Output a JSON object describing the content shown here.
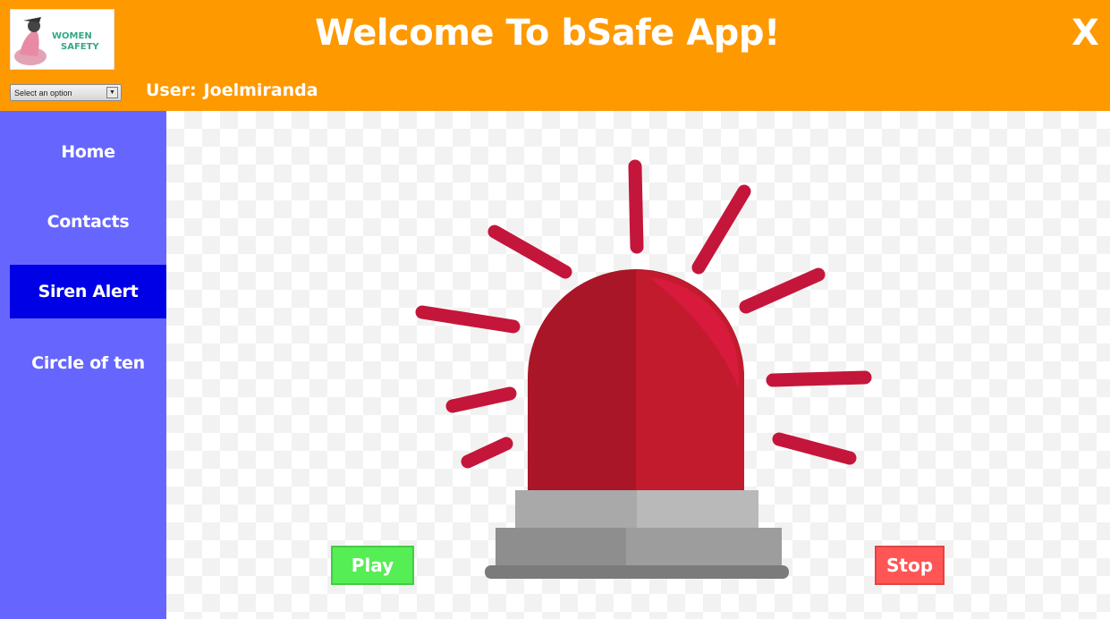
{
  "header": {
    "title": "Welcome To bSafe App!",
    "close_label": "X",
    "logo": {
      "text_line1": "WOMEN",
      "text_line2": "SAFETY"
    },
    "select": {
      "value": "Select an option",
      "arrow": "▼"
    },
    "user": {
      "label": "User:",
      "name": "Joelmiranda"
    }
  },
  "sidebar": {
    "items": [
      {
        "label": "Home",
        "active": false
      },
      {
        "label": "Contacts",
        "active": false
      },
      {
        "label": "Siren Alert",
        "active": true
      },
      {
        "label": "Circle of ten",
        "active": false
      }
    ]
  },
  "main": {
    "illustration": "siren-alarm-icon",
    "play_label": "Play",
    "stop_label": "Stop"
  },
  "colors": {
    "header": "#ff9900",
    "sidebar": "#6666ff",
    "sidebar_active": "#0000e6",
    "siren_red": "#c4163a",
    "play": "#55ee55",
    "stop": "#ff5555"
  }
}
